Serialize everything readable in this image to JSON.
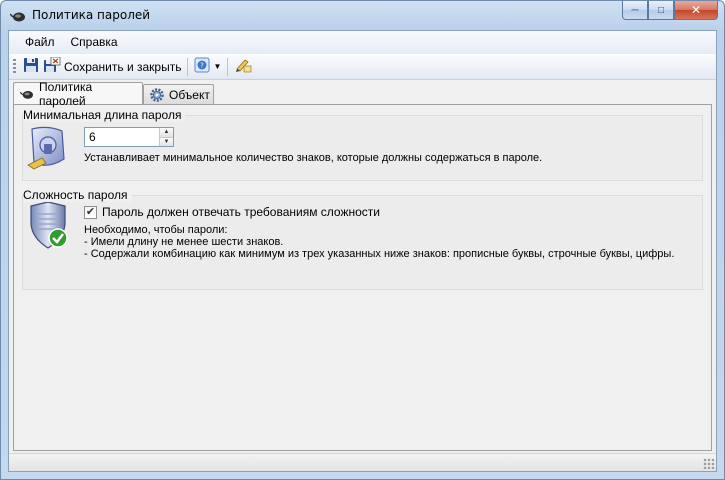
{
  "window": {
    "title": "Политика паролей",
    "app_icon": "mouse-icon",
    "controls": {
      "minimize": "─",
      "maximize": "□",
      "close": "✕"
    }
  },
  "menu": {
    "items": [
      {
        "label": "Файл"
      },
      {
        "label": "Справка"
      }
    ]
  },
  "toolbar": {
    "save_close_label": "Сохранить и закрыть",
    "icons": [
      "save-icon",
      "save-close-icon",
      "help-icon",
      "edit-icon"
    ]
  },
  "tabs": [
    {
      "label": "Политика паролей",
      "icon": "mouse-icon",
      "active": true
    },
    {
      "label": "Объект",
      "icon": "gear-icon",
      "active": false
    }
  ],
  "min_length": {
    "group_title": "Минимальная длина пароля",
    "value": "6",
    "description": "Устанавливает минимальное количество знаков, которые должны содержаться в пароле."
  },
  "complexity": {
    "group_title": "Сложность пароля",
    "checkbox_label": "Пароль должен отвечать требованиям сложности",
    "checked": true,
    "requirements": [
      "Необходимо, чтобы пароли:",
      "- Имели длину не менее шести знаков.",
      "- Содержали комбинацию как минимум из трех указанных ниже знаков: прописные буквы, строчные буквы, цифры."
    ]
  }
}
